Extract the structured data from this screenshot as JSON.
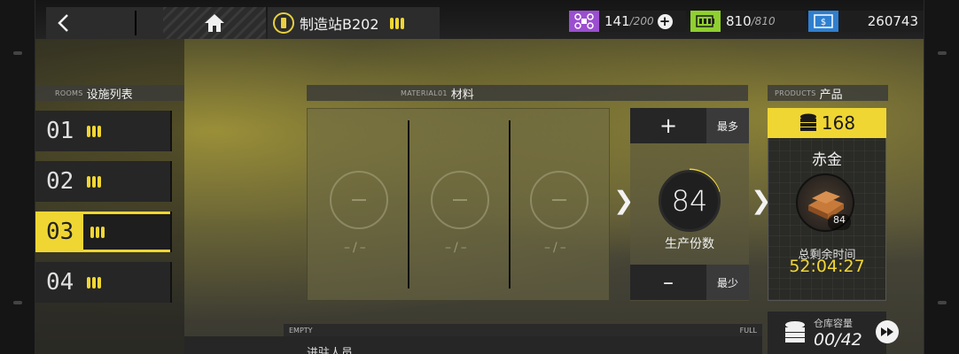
{
  "header": {
    "station_title": "制造站B202",
    "resources": [
      {
        "icon": "drone-icon",
        "value": "141",
        "max": "/200",
        "color": "#9b4fd0"
      },
      {
        "icon": "battery-icon",
        "value": "810",
        "max": "/810",
        "color": "#8fcf2f"
      },
      {
        "icon": "cash-icon",
        "value": "260743",
        "color": "#2f7fd0"
      }
    ]
  },
  "rooms": {
    "label_en": "ROOMS",
    "label_zh": "设施列表",
    "items": [
      {
        "num": "01",
        "active": false
      },
      {
        "num": "02",
        "active": false
      },
      {
        "num": "03",
        "active": true
      },
      {
        "num": "04",
        "active": false
      }
    ]
  },
  "materials": {
    "label_en": "MATERIAL01",
    "label_zh": "材料",
    "slots": [
      {
        "qty": "–/–"
      },
      {
        "qty": "–/–"
      },
      {
        "qty": "–/–"
      }
    ]
  },
  "production": {
    "plus": "+",
    "max_label": "最多",
    "count": "84",
    "count_label": "生产份数",
    "minus": "–",
    "min_label": "最少"
  },
  "product": {
    "label_en": "PRODUCTS",
    "label_zh": "产品",
    "coin_value": "168",
    "name": "赤金",
    "badge": "84",
    "time_label": "总剩余时间",
    "time": "52:04:27"
  },
  "storage": {
    "label": "仓库容量",
    "value": "00/42"
  },
  "bottom": {
    "empty": "EMPTY",
    "full": "FULL",
    "text": "进驻人员"
  },
  "colors": {
    "accent": "#f0d633"
  }
}
